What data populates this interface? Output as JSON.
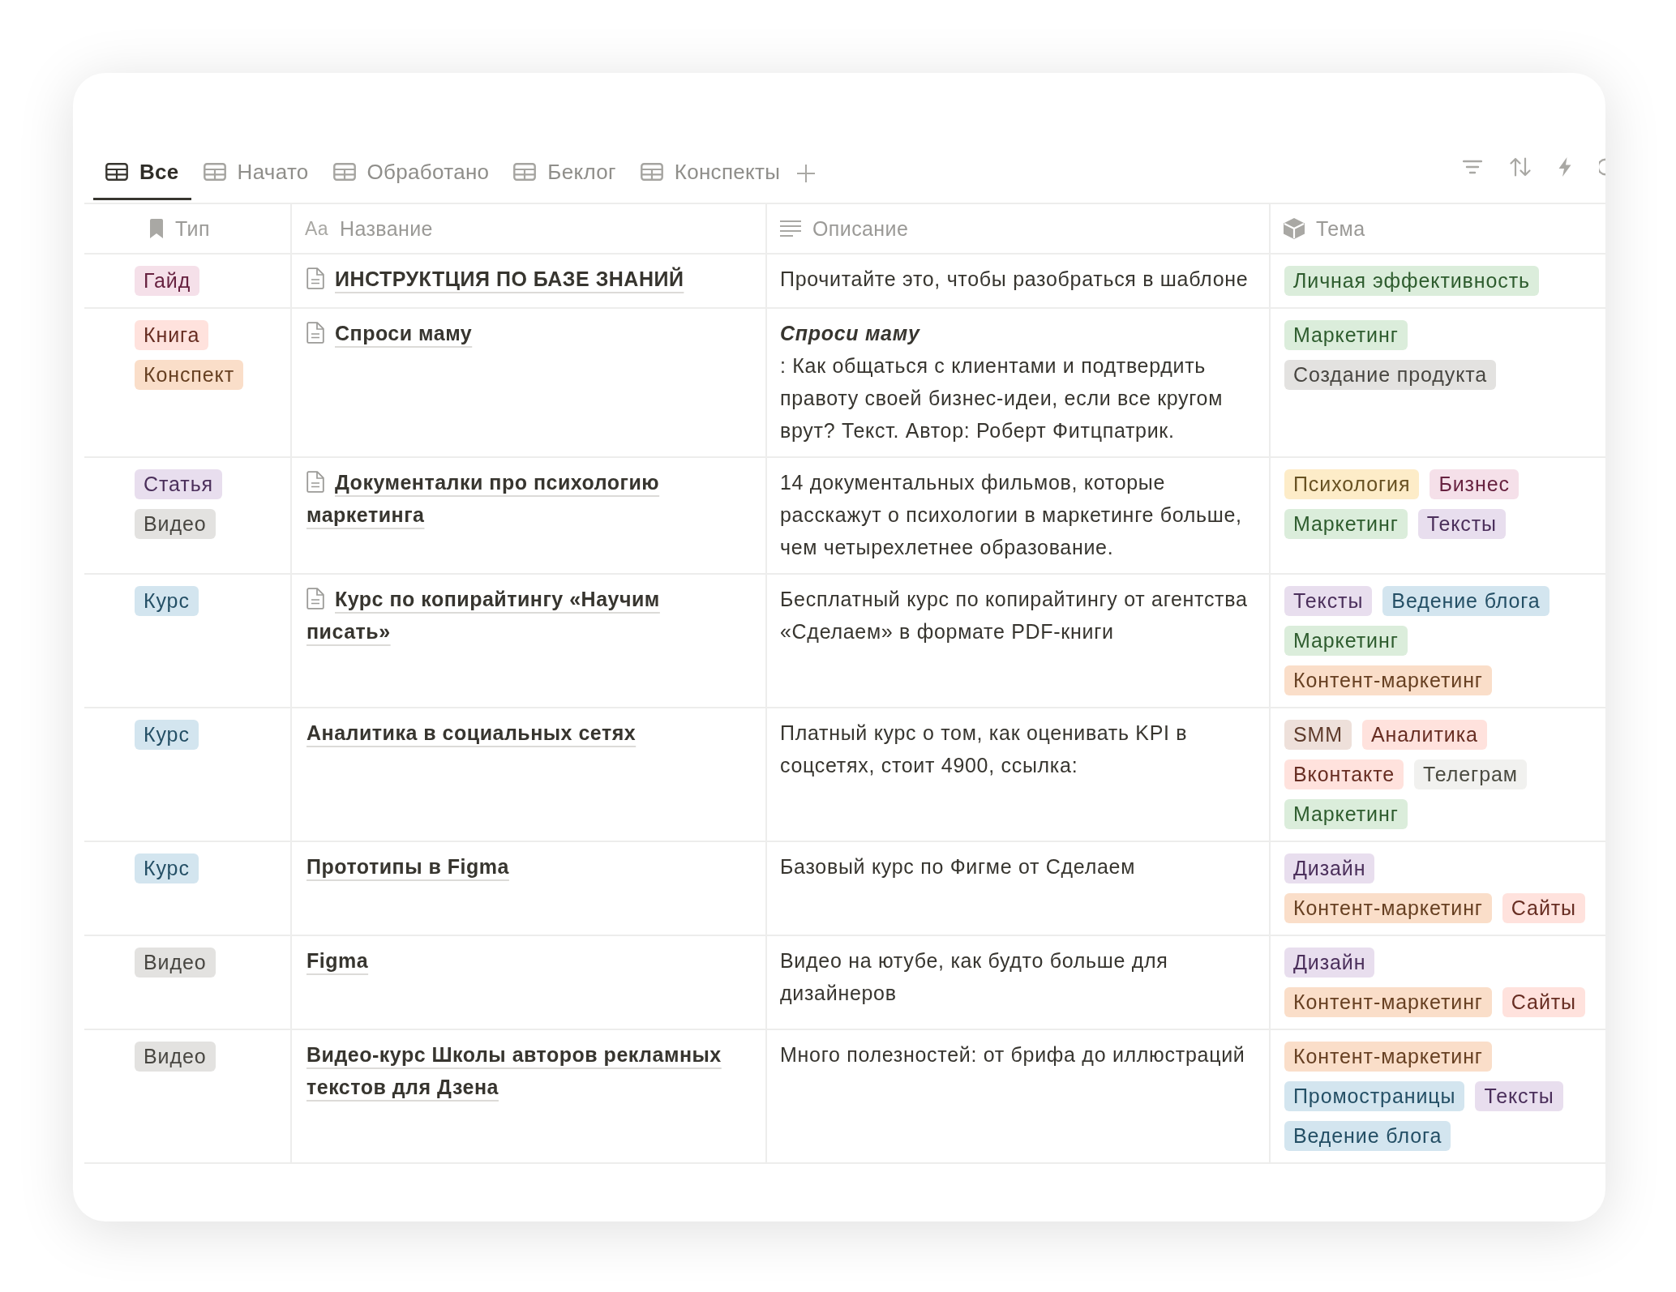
{
  "tabs": [
    {
      "label": "Все",
      "selected": true
    },
    {
      "label": "Начато",
      "selected": false
    },
    {
      "label": "Обработано",
      "selected": false
    },
    {
      "label": "Беклог",
      "selected": false
    },
    {
      "label": "Конспекты",
      "selected": false
    }
  ],
  "table": {
    "columns": [
      {
        "label": "Тип"
      },
      {
        "glyph": "Aa",
        "label": "Название"
      },
      {
        "label": "Описание"
      },
      {
        "label": "Тема"
      }
    ],
    "rows": [
      {
        "type": [
          {
            "label": "Гайд",
            "color": "#f5e0e9"
          }
        ],
        "title": "ИНСТРУКТЦИЯ ПО БАЗЕ ЗНАНИЙ",
        "page_icon": true,
        "description": "Прочитайте это, чтобы разобраться в шаблоне",
        "topics": [
          {
            "label": "Личная эффективность",
            "color": "#dbeddb"
          }
        ]
      },
      {
        "type": [
          {
            "label": "Книга",
            "color": "#ffe2dd"
          },
          {
            "label": "Конспект",
            "color": "#fadec9"
          }
        ],
        "title": "Спроси маму",
        "page_icon": true,
        "description": "*Спроси маму*\n: Как общаться с клиентами и подтвердить правоту своей бизнес-идеи, если все кругом врут? Текст. Автор: Роберт Фитцпатрик.",
        "topics": [
          {
            "label": "Маркетинг",
            "color": "#dbeddb"
          },
          {
            "label": "Создание продукта",
            "color": "#e3e2e0"
          }
        ]
      },
      {
        "type": [
          {
            "label": "Статья",
            "color": "#e8deee"
          },
          {
            "label": "Видео",
            "color": "#e3e2e0"
          }
        ],
        "title": "Документалки про психологию маркетинга",
        "page_icon": true,
        "description": "14 документальных фильмов, которые расскажут о психологии в маркетинге больше, чем четырехлетнее образование.",
        "topics": [
          {
            "label": "Психология",
            "color": "#fdecc8"
          },
          {
            "label": "Бизнес",
            "color": "#f5e0e9"
          },
          {
            "label": "Маркетинг",
            "color": "#dbeddb"
          },
          {
            "label": "Тексты",
            "color": "#e8deee"
          }
        ]
      },
      {
        "type": [
          {
            "label": "Курс",
            "color": "#d3e5ef"
          }
        ],
        "title": "Курс по копирайтингу «Научим писать»",
        "page_icon": true,
        "description": "Бесплатный курс по копирайтингу от агентства «Сделаем» в формате PDF-книги",
        "topics": [
          {
            "label": "Тексты",
            "color": "#e8deee"
          },
          {
            "label": "Ведение блога",
            "color": "#d3e5ef"
          },
          {
            "label": "Маркетинг",
            "color": "#dbeddb"
          },
          {
            "label": "Контент-маркетинг",
            "color": "#fadec9"
          }
        ]
      },
      {
        "type": [
          {
            "label": "Курс",
            "color": "#d3e5ef"
          }
        ],
        "title": "Аналитика в социальных сетях",
        "page_icon": false,
        "description": "Платный курс о том, как оценивать KPI в соцсетях, стоит 4900, ссылка:",
        "topics": [
          {
            "label": "SMM",
            "color": "#eee0da"
          },
          {
            "label": "Аналитика",
            "color": "#ffe2dd"
          },
          {
            "label": "Вконтакте",
            "color": "#ffe2dd"
          },
          {
            "label": "Телеграм",
            "color": "#f1f1ef"
          },
          {
            "label": "Маркетинг",
            "color": "#dbeddb"
          }
        ]
      },
      {
        "type": [
          {
            "label": "Курс",
            "color": "#d3e5ef"
          }
        ],
        "title": "Прототипы в Figma",
        "page_icon": false,
        "description": "Базовый курс по Фигме от Сделаем",
        "topics": [
          {
            "label": "Дизайн",
            "color": "#e8deee"
          },
          {
            "label": "Контент-маркетинг",
            "color": "#fadec9"
          },
          {
            "label": "Сайты",
            "color": "#ffe2dd"
          }
        ]
      },
      {
        "type": [
          {
            "label": "Видео",
            "color": "#e3e2e0"
          }
        ],
        "title": "Figma",
        "page_icon": false,
        "description": "Видео на ютубе, как будто больше для дизайнеров",
        "topics": [
          {
            "label": "Дизайн",
            "color": "#e8deee"
          },
          {
            "label": "Контент-маркетинг",
            "color": "#fadec9"
          },
          {
            "label": "Сайты",
            "color": "#ffe2dd"
          }
        ]
      },
      {
        "type": [
          {
            "label": "Видео",
            "color": "#e3e2e0"
          }
        ],
        "title": "Видео-курс Школы авторов рекламных текстов для Дзена",
        "page_icon": false,
        "description": "Много полезностей: от брифа до иллюстраций",
        "topics": [
          {
            "label": "Контент-маркетинг",
            "color": "#fadec9"
          },
          {
            "label": "Промостраницы",
            "color": "#d3e5ef"
          },
          {
            "label": "Тексты",
            "color": "#e8deee"
          },
          {
            "label": "Ведение блога",
            "color": "#d3e5ef"
          }
        ]
      }
    ]
  }
}
